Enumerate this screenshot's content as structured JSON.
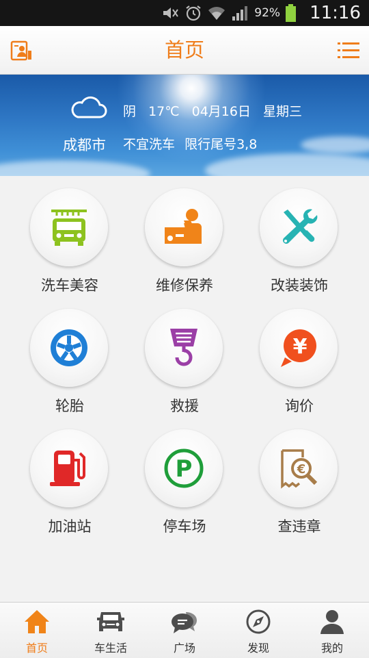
{
  "status_bar": {
    "battery": "92%",
    "time": "11:16"
  },
  "header": {
    "title": "首页"
  },
  "weather": {
    "condition": "阴",
    "temperature": "17℃",
    "date": "04月16日",
    "weekday": "星期三",
    "city": "成都市",
    "car_wash": "不宜洗车",
    "restriction": "限行尾号3,8"
  },
  "services": [
    {
      "label": "洗车美容",
      "icon": "car-wash-icon",
      "color": "#8dc21f"
    },
    {
      "label": "维修保养",
      "icon": "repair-icon",
      "color": "#f08419"
    },
    {
      "label": "改装装饰",
      "icon": "tools-icon",
      "color": "#27b3b3"
    },
    {
      "label": "轮胎",
      "icon": "tire-icon",
      "color": "#1f7fd6"
    },
    {
      "label": "救援",
      "icon": "tow-hook-icon",
      "color": "#9b3fa6"
    },
    {
      "label": "询价",
      "icon": "price-icon",
      "color": "#f0501e"
    },
    {
      "label": "加油站",
      "icon": "gas-pump-icon",
      "color": "#e02828"
    },
    {
      "label": "停车场",
      "icon": "parking-icon",
      "color": "#1f9e3a"
    },
    {
      "label": "查违章",
      "icon": "violation-search-icon",
      "color": "#a87d4a"
    }
  ],
  "tabs": [
    {
      "label": "首页",
      "icon": "home-icon",
      "active": true
    },
    {
      "label": "车生活",
      "icon": "car-life-icon",
      "active": false
    },
    {
      "label": "广场",
      "icon": "chat-icon",
      "active": false
    },
    {
      "label": "发现",
      "icon": "compass-icon",
      "active": false
    },
    {
      "label": "我的",
      "icon": "user-icon",
      "active": false
    }
  ],
  "colors": {
    "accent": "#ef7d1a",
    "text": "#333333"
  }
}
